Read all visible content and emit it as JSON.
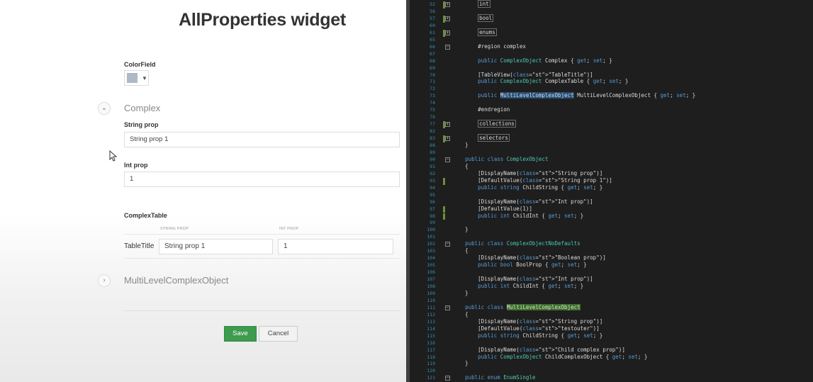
{
  "form": {
    "title": "AllProperties widget",
    "color_field_label": "ColorField",
    "complex_section": "Complex",
    "string_prop_label": "String prop",
    "string_prop_value": "String prop 1",
    "int_prop_label": "Int prop",
    "int_prop_value": "1",
    "complex_table_label": "ComplexTable",
    "table_headers": [
      "STRING PROP",
      "INT PROP"
    ],
    "table_row_label": "TableTitle",
    "table_cells": [
      "String prop 1",
      "1"
    ],
    "multilevel_section": "MultiLevelComplexObject",
    "save_label": "Save",
    "cancel_label": "Cancel",
    "color_value": "#aeb8c6",
    "save_color": "#3e9b4f"
  },
  "editor": {
    "lines": [
      {
        "n": "52",
        "t": "        int"
      },
      {
        "n": "56",
        "t": ""
      },
      {
        "n": "57",
        "t": "        bool"
      },
      {
        "n": "60",
        "t": ""
      },
      {
        "n": "61",
        "t": "        enums"
      },
      {
        "n": "65",
        "t": ""
      },
      {
        "n": "66",
        "t": "        #region complex"
      },
      {
        "n": "67",
        "t": ""
      },
      {
        "n": "68",
        "t": "        public ComplexObject Complex { get; set; }"
      },
      {
        "n": "69",
        "t": ""
      },
      {
        "n": "70",
        "t": "        [TableView(\"TableTitle\")]"
      },
      {
        "n": "71",
        "t": "        public ComplexObject ComplexTable { get; set; }"
      },
      {
        "n": "72",
        "t": ""
      },
      {
        "n": "73",
        "t": "        public MultiLevelComplexObject MultiLevelComplexObject { get; set; }"
      },
      {
        "n": "74",
        "t": ""
      },
      {
        "n": "75",
        "t": "        #endregion"
      },
      {
        "n": "76",
        "t": ""
      },
      {
        "n": "77",
        "t": "        collections"
      },
      {
        "n": "82",
        "t": ""
      },
      {
        "n": "83",
        "t": "        selectors"
      },
      {
        "n": "88",
        "t": "    }"
      },
      {
        "n": "89",
        "t": ""
      },
      {
        "n": "90",
        "t": "    public class ComplexObject"
      },
      {
        "n": "91",
        "t": "    {"
      },
      {
        "n": "92",
        "t": "        [DisplayName(\"String prop\")]"
      },
      {
        "n": "93",
        "t": "        [DefaultValue(\"String prop 1\")]"
      },
      {
        "n": "94",
        "t": "        public string ChildString { get; set; }"
      },
      {
        "n": "95",
        "t": ""
      },
      {
        "n": "96",
        "t": "        [DisplayName(\"Int prop\")]"
      },
      {
        "n": "97",
        "t": "        [DefaultValue(1)]"
      },
      {
        "n": "98",
        "t": "        public int ChildInt { get; set; }"
      },
      {
        "n": "99",
        "t": ""
      },
      {
        "n": "100",
        "t": "    }"
      },
      {
        "n": "101",
        "t": ""
      },
      {
        "n": "102",
        "t": "    public class ComplexObjectNoDefaults"
      },
      {
        "n": "103",
        "t": "    {"
      },
      {
        "n": "104",
        "t": "        [DisplayName(\"Boolean prop\")]"
      },
      {
        "n": "105",
        "t": "        public bool BoolProp { get; set; }"
      },
      {
        "n": "106",
        "t": ""
      },
      {
        "n": "107",
        "t": "        [DisplayName(\"Int prop\")]"
      },
      {
        "n": "108",
        "t": "        public int ChildInt { get; set; }"
      },
      {
        "n": "109",
        "t": "    }"
      },
      {
        "n": "110",
        "t": ""
      },
      {
        "n": "111",
        "t": "    public class MultiLevelComplexObject"
      },
      {
        "n": "112",
        "t": "    {"
      },
      {
        "n": "113",
        "t": "        [DisplayName(\"String prop\")]"
      },
      {
        "n": "114",
        "t": "        [DefaultValue(\"testouter\")]"
      },
      {
        "n": "115",
        "t": "        public string ChildString { get; set; }"
      },
      {
        "n": "116",
        "t": ""
      },
      {
        "n": "117",
        "t": "        [DisplayName(\"Child complex prop\")]"
      },
      {
        "n": "118",
        "t": "        public ComplexObject ChildComplexObject { get; set; }"
      },
      {
        "n": "119",
        "t": "    }"
      },
      {
        "n": "120",
        "t": ""
      },
      {
        "n": "121",
        "t": "    public enum EnumSingle"
      }
    ]
  }
}
